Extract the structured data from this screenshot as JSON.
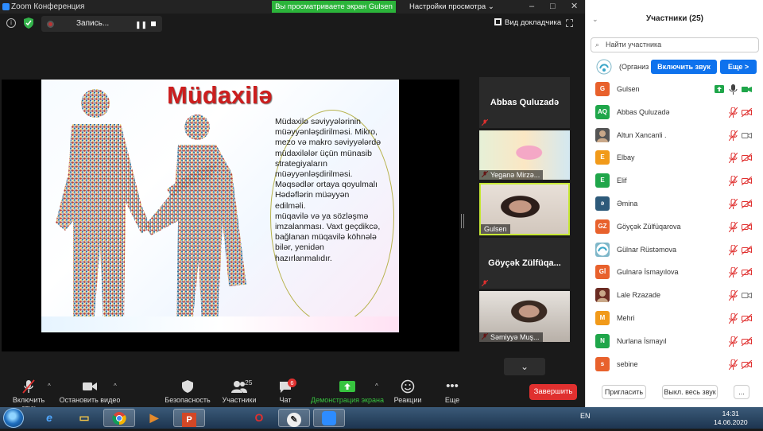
{
  "window": {
    "title": "Zoom Конференция",
    "share_banner": "Вы просматриваете экран Gulsen",
    "view_options": "Настройки просмотра",
    "view_options_icon": "chevron-down-icon"
  },
  "topbar": {
    "recording_label": "Запись...",
    "speaker_view_label": "Вид докладчика"
  },
  "slide": {
    "title": "Müdaxilə",
    "body": "Müdaxilə səviyyələrinin müəyyənləşdirilməsi. Mikro, mezo və makro səviyyələrdə müdaxilələr üçün münasib strategiyaların müəyyənləşdirilməsi.\n  Məqsədlər ortaya qoyulmalı\n  Hədəflərin müəyyən edilməli.\n müqavilə və ya sözləşmə imzalanması. Vaxt geçdikcə, bağlanan müqavilə köhnələ bilər, yenidən hazırlanmalıdır."
  },
  "video_tiles": [
    {
      "name": "Abbas Quluzadə",
      "type": "name-only"
    },
    {
      "name": "Yeganə Mirzə...",
      "type": "video"
    },
    {
      "name": "Gulsen",
      "type": "video",
      "active": true
    },
    {
      "name": "Göyçək  Zülfüqa...",
      "type": "name-only"
    },
    {
      "name": "Səmiyyə Muş...",
      "type": "video"
    }
  ],
  "toolbar": {
    "audio": "Включить звук",
    "video": "Остановить видео",
    "security": "Безопасность",
    "participants": "Участники",
    "participants_count": "25",
    "chat": "Чат",
    "chat_badge": "6",
    "share": "Демонстрация экрана",
    "reactions": "Реакции",
    "more": "Еще",
    "end": "Завершить"
  },
  "panel": {
    "title": "Участники (25)",
    "search_placeholder": "Найти участника",
    "host_label": "(Организ",
    "unmute_button": "Включить звук",
    "more_button": "Еще >",
    "invite_button": "Пригласить",
    "mute_all_button": "Выкл. весь звук",
    "more_dots": "...",
    "participants": [
      {
        "initials": "G",
        "name": "Gulsen",
        "color": "#e8612c",
        "mic": "on",
        "cam": "on"
      },
      {
        "initials": "AQ",
        "name": "Abbas Quluzadə",
        "color": "#1fa64a",
        "mic": "muted",
        "cam": "off"
      },
      {
        "initials": "",
        "name": "Altun Xancanli .",
        "color": "#555555",
        "mic": "muted",
        "cam": "on-gray"
      },
      {
        "initials": "E",
        "name": "Elbay",
        "color": "#f19a1a",
        "mic": "muted",
        "cam": "off"
      },
      {
        "initials": "E",
        "name": "Elif",
        "color": "#1fa64a",
        "mic": "muted",
        "cam": "off"
      },
      {
        "initials": "ə",
        "name": "Əmina",
        "color": "#2d5a7a",
        "mic": "muted",
        "cam": "off"
      },
      {
        "initials": "GZ",
        "name": "Göyçək Zülfüqarova",
        "color": "#e8612c",
        "mic": "muted",
        "cam": "off"
      },
      {
        "initials": "",
        "name": "Gülnar Rüstəmova",
        "color": "#7fb7c9",
        "mic": "muted",
        "cam": "off"
      },
      {
        "initials": "Gİ",
        "name": "Gulnarə İsmayılova",
        "color": "#e8612c",
        "mic": "muted",
        "cam": "off"
      },
      {
        "initials": "",
        "name": "Lale Rzazade",
        "color": "#6b2c23",
        "mic": "muted",
        "cam": "on-gray"
      },
      {
        "initials": "M",
        "name": "Mehri",
        "color": "#f19a1a",
        "mic": "muted",
        "cam": "off"
      },
      {
        "initials": "N",
        "name": "Nurlana İsmayıl",
        "color": "#1fa64a",
        "mic": "muted",
        "cam": "off"
      },
      {
        "initials": "s",
        "name": "sebine",
        "color": "#e8612c",
        "mic": "muted",
        "cam": "off"
      }
    ]
  },
  "taskbar": {
    "language": "EN",
    "time": "14:31",
    "date": "14.06.2020"
  }
}
